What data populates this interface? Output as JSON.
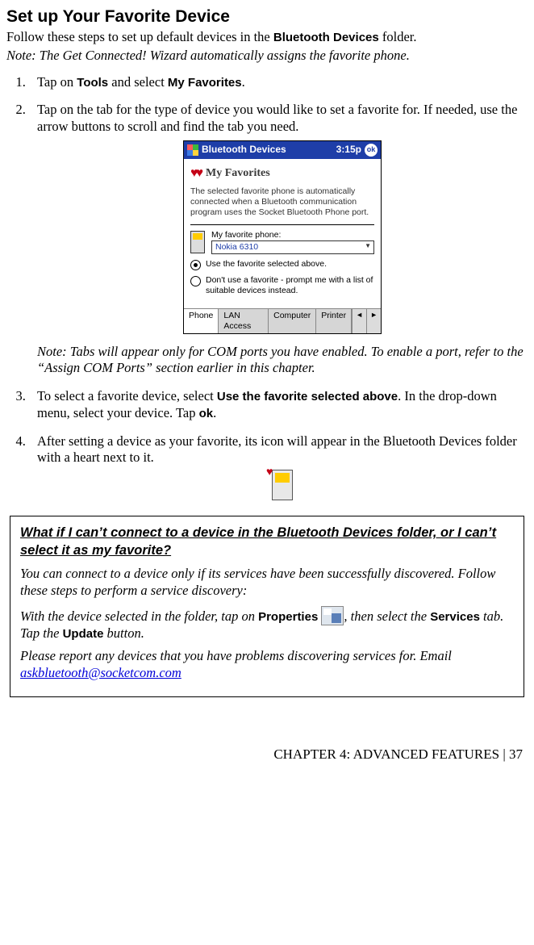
{
  "title": "Set up Your Favorite Device",
  "intro_a": "Follow these steps to set up default devices in the ",
  "intro_bold": "Bluetooth Devices",
  "intro_b": " folder.",
  "intro_note": "Note: The Get Connected! Wizard automatically assigns the favorite phone.",
  "steps": {
    "s1_a": "Tap on ",
    "s1_tools": "Tools",
    "s1_b": " and select ",
    "s1_fav": "My Favorites",
    "s1_c": ".",
    "s2": "Tap on the tab for the type of device you would like to set a favorite for. If needed, use the arrow buttons to scroll and find the tab you need.",
    "s2_note": "Note: Tabs will appear only for COM ports you have enabled. To enable a port, refer to the “Assign COM Ports” section earlier in this chapter.",
    "s3_a": "To select a favorite device, select ",
    "s3_opt": "Use the favorite selected above",
    "s3_b": ". In the drop-down menu, select your device. Tap ",
    "s3_ok": "ok",
    "s3_c": ".",
    "s4": "After setting a device as your favorite, its icon will appear in the Bluetooth Devices folder with a heart next to it."
  },
  "ppc": {
    "title": "Bluetooth Devices",
    "time": "3:15p",
    "ok": "ok",
    "header": "My Favorites",
    "desc": "The selected favorite phone is automatically connected when a Bluetooth communication program uses the Socket Bluetooth Phone port.",
    "label": "My favorite phone:",
    "selected": "Nokia 6310",
    "radio1": "Use the favorite selected above.",
    "radio2": "Don't use a favorite - prompt me with a list of suitable devices instead.",
    "tabs": [
      "Phone",
      "LAN Access",
      "Computer",
      "Printer"
    ],
    "arrow_left": "◄",
    "arrow_right": "►"
  },
  "ts": {
    "title": "What if I can’t connect to a device in the Bluetooth Devices folder, or I can’t select it as my favorite?",
    "p1": "You can connect to a device only if its services have been successfully discovered. Follow these steps to perform a service discovery:",
    "p2a": "With the device selected in the folder, tap on ",
    "p2_prop": "Properties",
    "p2b": ", then s",
    "p2c": "elect the ",
    "p2_serv": "Services",
    "p2d": " tab. Tap the ",
    "p2_upd": "Update",
    "p2e": " button.",
    "p3a": "Please report any devices that you have problems discovering services for. Email ",
    "email": "askbluetooth@socketcom.com"
  },
  "footer": "CHAPTER 4: ADVANCED FEATURES | 37"
}
